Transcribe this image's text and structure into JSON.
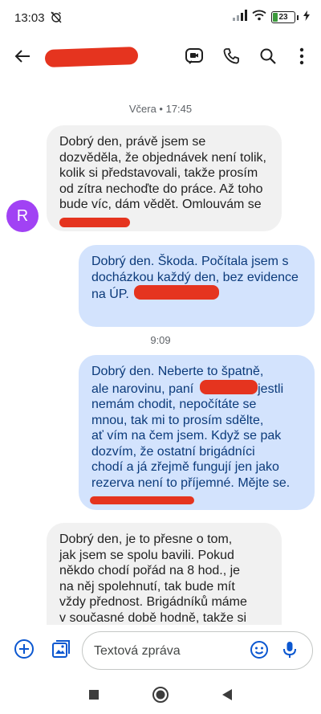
{
  "status_bar": {
    "time": "13:03",
    "battery_level": "23",
    "battery_fraction": 0.23
  },
  "app_bar": {
    "back_icon": "arrow-back-icon",
    "contact_name": "",
    "actions": [
      "meet-video-icon",
      "phone-icon",
      "search-icon",
      "more-vert-icon"
    ]
  },
  "conversation": {
    "day_label_1": "Včera • 17:45",
    "message_1": {
      "avatar_letter": "R",
      "lines": [
        "Dobrý den, právě jsem se",
        "dozvěděla, že objednávek není tolik,",
        "kolik si představovali, takže prosím",
        "od zítra nechoďte do práce. Až toho",
        "bude víc, dám vědět. Omlouvám se"
      ]
    },
    "message_2": {
      "lines": [
        "Dobrý den. Škoda. Počítala jsem s",
        "docházkou každý den, bez evidence",
        "na ÚP."
      ]
    },
    "day_label_2": "9:09",
    "message_3": {
      "line_1": "Dobrý den. Neberte to špatně,",
      "line_2_prefix": "ale narovinu, paní",
      "line_2_suffix": "jestli",
      "lines_rest": [
        "nemám chodit, nepočítáte se",
        "mnou, tak mi to prosím sdělte,",
        "ať vím na čem jsem. Když se pak",
        "dozvím, že  ostatní brigádníci",
        "chodí a já zřejmě fungují jen jako",
        "rezerva není to příjemné. Mějte se."
      ]
    },
    "message_4": {
      "lines": [
        "Dobrý den, je to přesne o tom,",
        "jak jsem se spolu bavili. Pokud",
        "někdo chodí pořád na 8 hod., je",
        "na něj spolehnutí, tak bude mít",
        "vždy přednost. Brigádníků máme",
        "v současné době hodně, takže si"
      ]
    }
  },
  "compose": {
    "placeholder": "Textová zpráva",
    "add_icon": "add-circle-icon",
    "gallery_icon": "gallery-icon",
    "emoji_icon": "emoji-icon",
    "mic_icon": "mic-icon"
  },
  "nav_bar": {
    "icons": [
      "recents-square-icon",
      "home-circle-icon",
      "back-triangle-icon"
    ]
  },
  "colors": {
    "incoming_bubble": "#f1f1f1",
    "outgoing_bubble": "#d3e3fd",
    "outgoing_text": "#0b3a7a",
    "avatar": "#a142f4",
    "accent": "#0b57d0",
    "redaction": "#e5341f"
  }
}
